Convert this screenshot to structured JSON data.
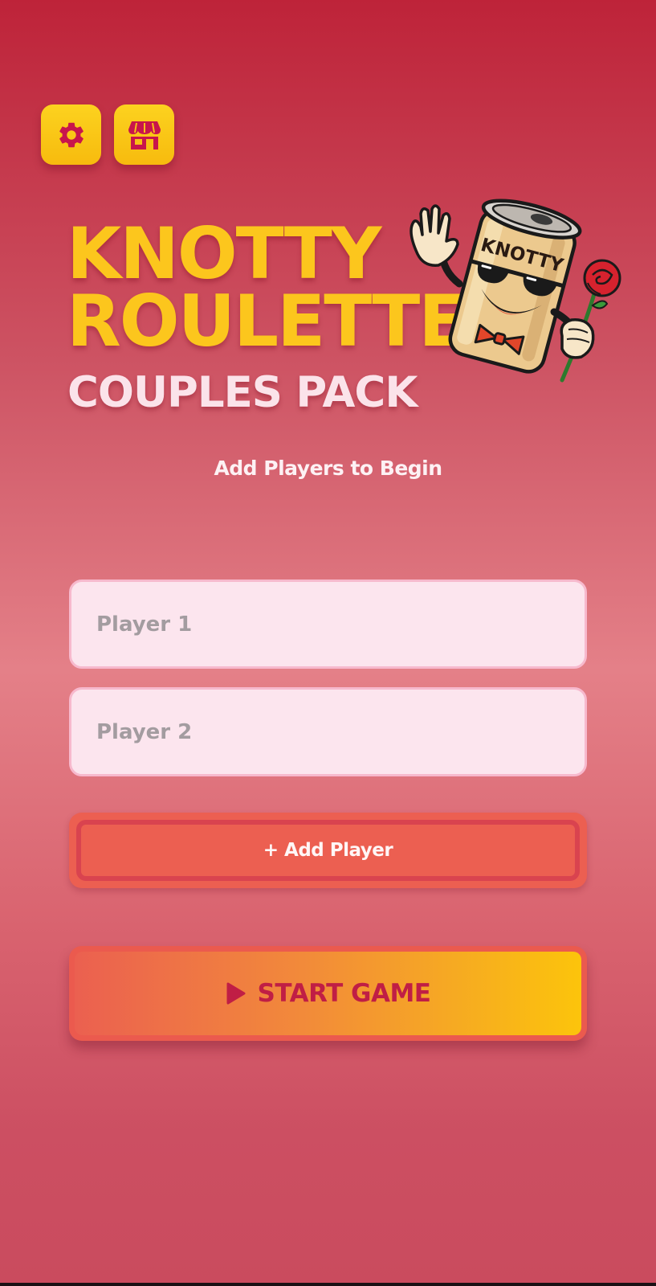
{
  "header": {
    "settings_icon": "gear-icon",
    "shop_icon": "storefront-icon"
  },
  "title": {
    "line1": "KNOTTY",
    "line2": "ROULETTE",
    "subtitle": "COUPLES PACK"
  },
  "mascot": {
    "can_text": "KNOTTY"
  },
  "prompt": "Add Players to Begin",
  "players": [
    {
      "placeholder": "Player 1",
      "value": ""
    },
    {
      "placeholder": "Player 2",
      "value": ""
    }
  ],
  "add_player_label": "+ Add Player",
  "start_button": {
    "label": "START GAME",
    "icon": "play-icon"
  },
  "colors": {
    "background_top": "#be2339",
    "background_mid": "#e48088",
    "title_yellow": "#fcc61d",
    "subtitle_pink": "#fbe3ea",
    "button_yellow": "#fcd21f",
    "accent_red": "#ec5f51",
    "start_text": "#c01e45",
    "input_bg": "#fce5ee"
  }
}
